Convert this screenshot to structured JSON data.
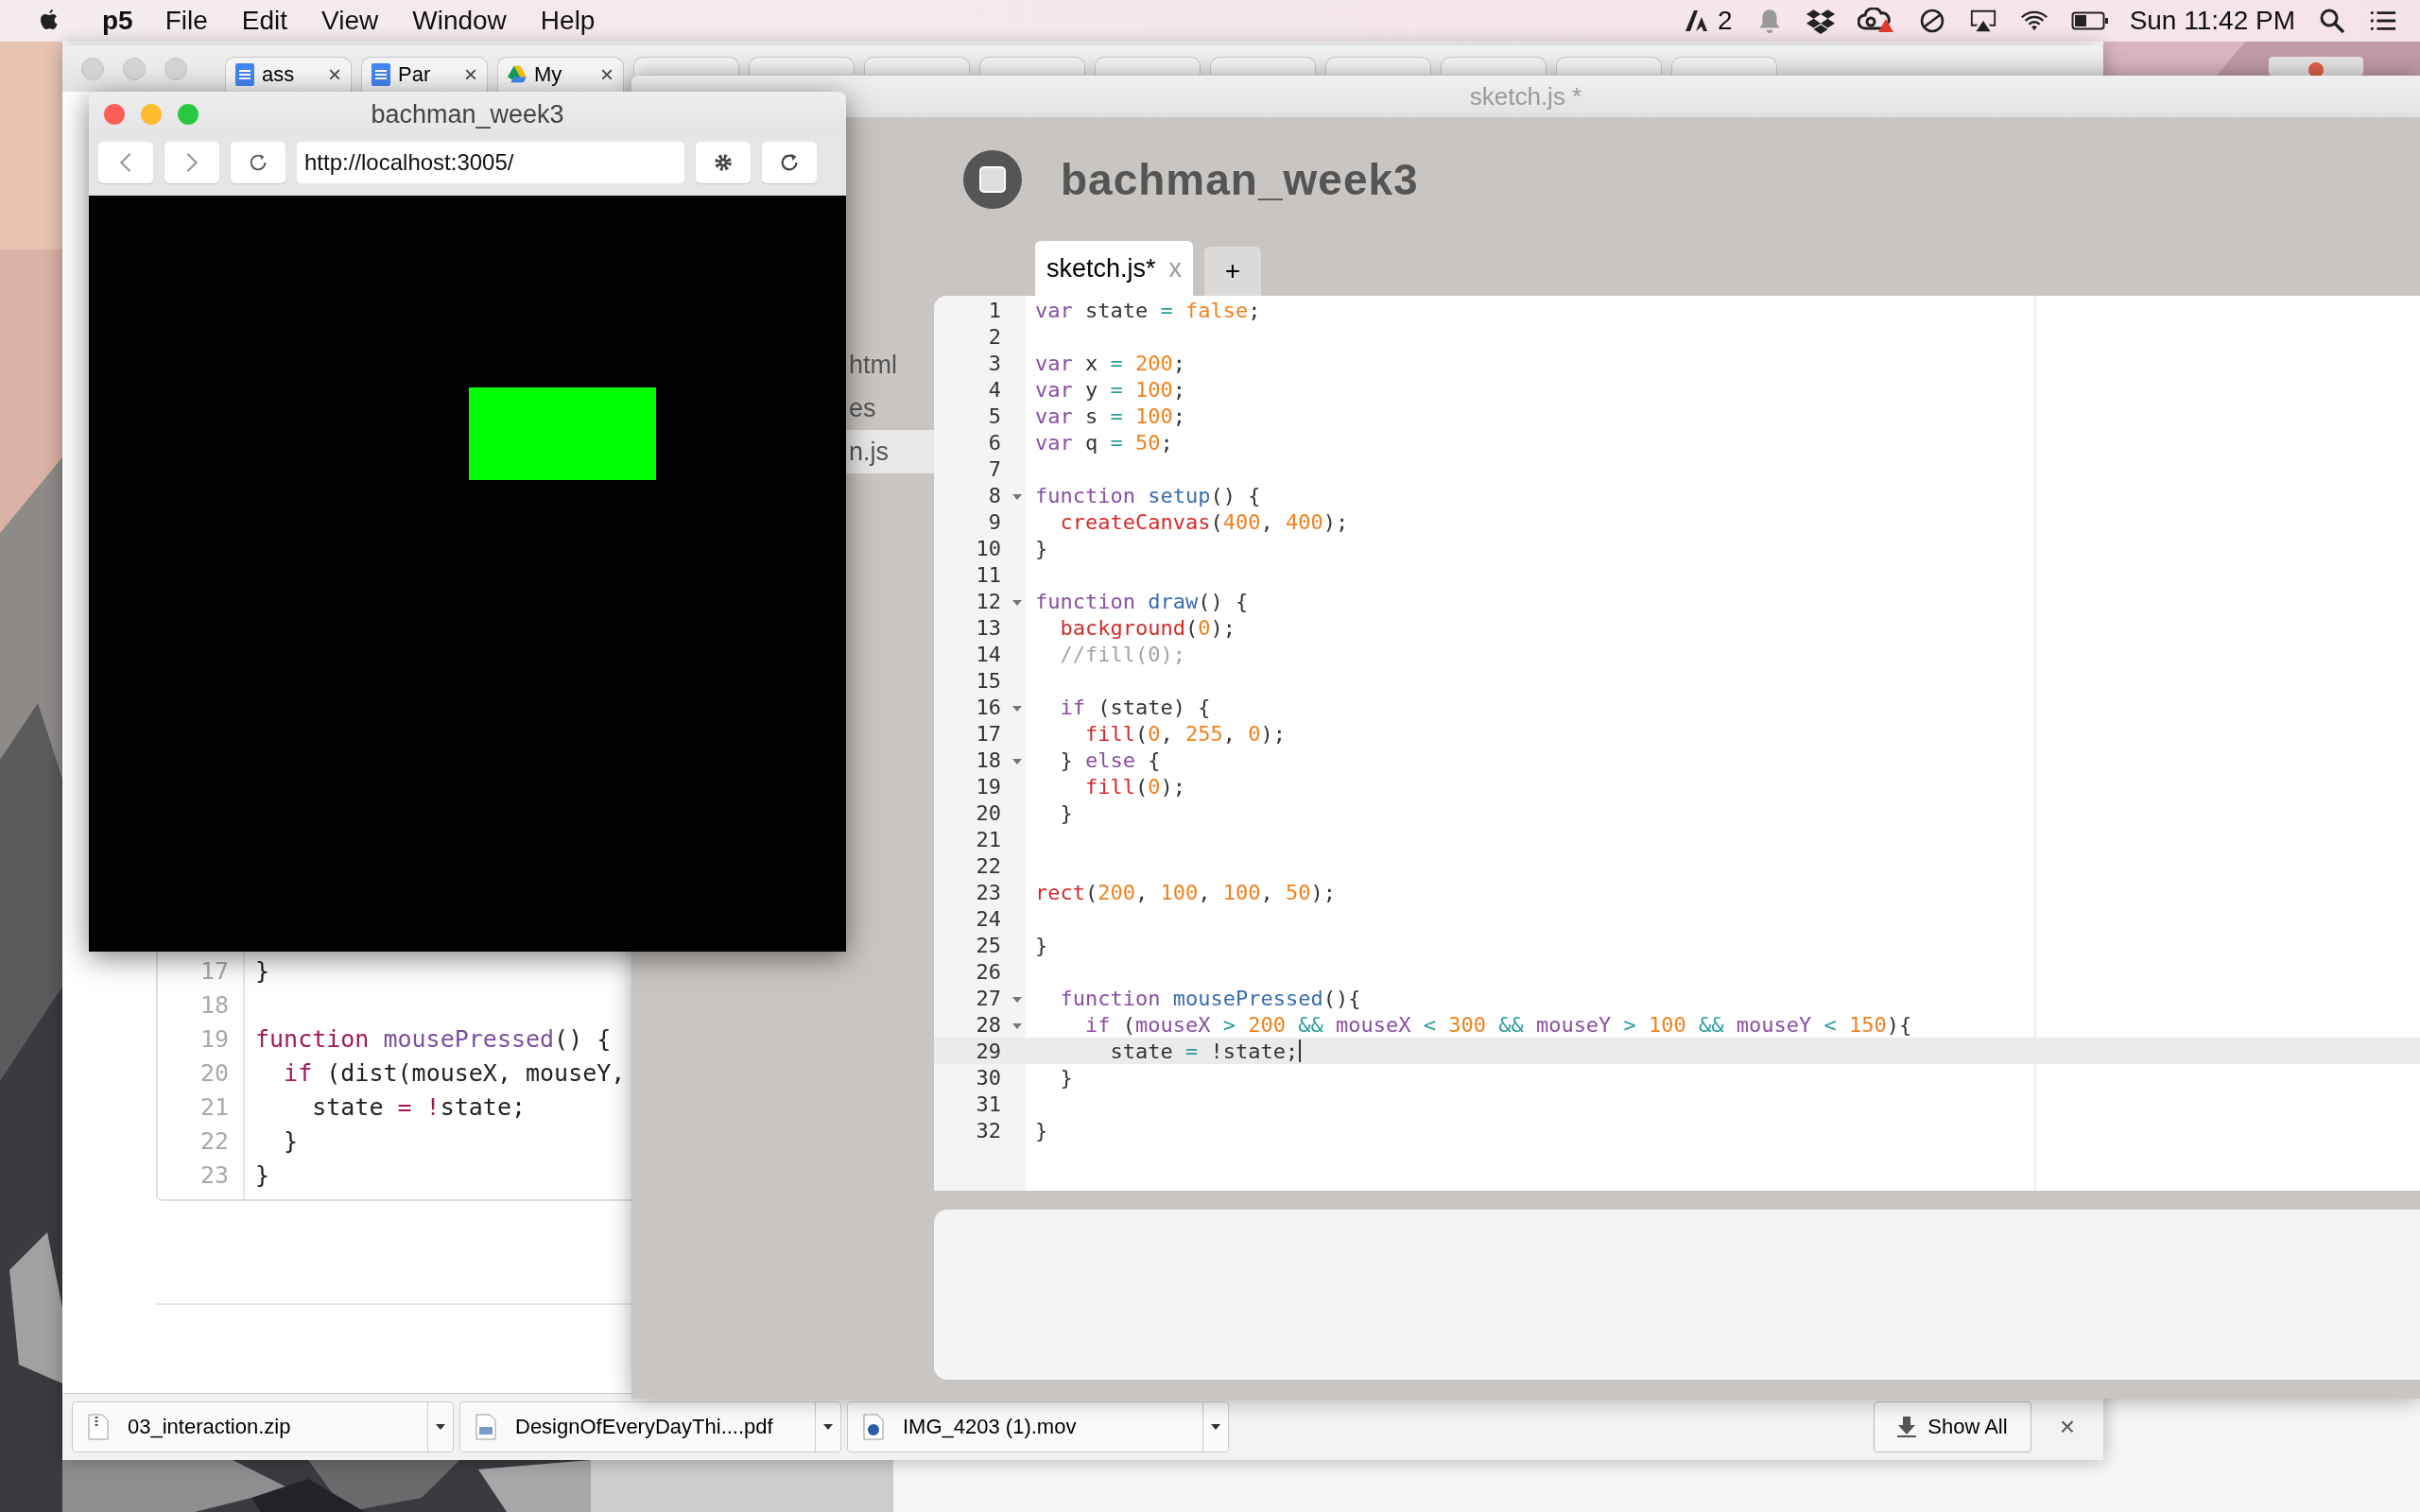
{
  "menu_bar": {
    "app": "p5",
    "menus": [
      "File",
      "Edit",
      "View",
      "Window",
      "Help"
    ],
    "adobe_count": "2",
    "clock": "Sun 11:42 PM"
  },
  "chrome": {
    "tabs": [
      {
        "kind": "doc",
        "title": "ass",
        "close": "×"
      },
      {
        "kind": "doc",
        "title": "Par",
        "close": "×"
      },
      {
        "kind": "drive",
        "title": "My",
        "close": "×"
      },
      {
        "kind": "covered"
      },
      {
        "kind": "covered"
      },
      {
        "kind": "covered"
      },
      {
        "kind": "covered"
      },
      {
        "kind": "covered"
      },
      {
        "kind": "covered"
      },
      {
        "kind": "covered"
      },
      {
        "kind": "covered"
      },
      {
        "kind": "covered"
      },
      {
        "kind": "covered"
      }
    ],
    "page_code": [
      {
        "number": "17",
        "tokens": [
          {
            "kind": "plain",
            "text": "}"
          }
        ]
      },
      {
        "number": "18"
      },
      {
        "number": "19",
        "tokens": [
          {
            "kind": "keyword",
            "text": "function "
          },
          {
            "kind": "name",
            "text": "mousePressed"
          },
          {
            "kind": "plain",
            "text": "() {"
          }
        ]
      },
      {
        "number": "20",
        "tokens": [
          {
            "kind": "keyword",
            "text": "  if"
          },
          {
            "kind": "plain",
            "text": " (dist(mouseX, mouseY,"
          }
        ]
      },
      {
        "number": "21",
        "tokens": [
          {
            "kind": "plain",
            "text": "    state "
          },
          {
            "kind": "op",
            "text": "= !"
          },
          {
            "kind": "plain",
            "text": "state;"
          }
        ]
      },
      {
        "number": "22",
        "tokens": [
          {
            "kind": "plain",
            "text": "  }"
          }
        ]
      },
      {
        "number": "23",
        "tokens": [
          {
            "kind": "plain",
            "text": "}"
          }
        ]
      }
    ],
    "downloads": [
      {
        "kind": "zip",
        "name": "03_interaction.zip"
      },
      {
        "kind": "pdf",
        "name": "DesignOfEveryDayThi....pdf"
      },
      {
        "kind": "video",
        "name": "IMG_4203 (1).mov"
      }
    ],
    "show_all": "Show All",
    "close": "×"
  },
  "ide": {
    "window_title": "sketch.js *",
    "project": "bachman_week3",
    "running": true,
    "files": [
      {
        "name": "html",
        "selected": false
      },
      {
        "name": "es",
        "selected": false
      },
      {
        "name": "n.js",
        "selected": true
      }
    ],
    "tabs": [
      {
        "title": "sketch.js*",
        "close": "x",
        "selected": true
      }
    ],
    "add_tab": "+",
    "code": [
      {
        "number": "1",
        "fold": false,
        "active": false,
        "tokens": [
          {
            "kind": "keyword",
            "text": "var "
          },
          {
            "kind": "plain",
            "text": "state "
          },
          {
            "kind": "op",
            "text": "= "
          },
          {
            "kind": "num",
            "text": "false"
          },
          {
            "kind": "plain",
            "text": ";"
          }
        ]
      },
      {
        "number": "2",
        "fold": false,
        "active": false
      },
      {
        "number": "3",
        "fold": false,
        "active": false,
        "tokens": [
          {
            "kind": "keyword",
            "text": "var "
          },
          {
            "kind": "plain",
            "text": "x "
          },
          {
            "kind": "op",
            "text": "= "
          },
          {
            "kind": "num",
            "text": "200"
          },
          {
            "kind": "plain",
            "text": ";"
          }
        ]
      },
      {
        "number": "4",
        "fold": false,
        "active": false,
        "tokens": [
          {
            "kind": "keyword",
            "text": "var "
          },
          {
            "kind": "plain",
            "text": "y "
          },
          {
            "kind": "op",
            "text": "= "
          },
          {
            "kind": "num",
            "text": "100"
          },
          {
            "kind": "plain",
            "text": ";"
          }
        ]
      },
      {
        "number": "5",
        "fold": false,
        "active": false,
        "tokens": [
          {
            "kind": "keyword",
            "text": "var "
          },
          {
            "kind": "plain",
            "text": "s "
          },
          {
            "kind": "op",
            "text": "= "
          },
          {
            "kind": "num",
            "text": "100"
          },
          {
            "kind": "plain",
            "text": ";"
          }
        ]
      },
      {
        "number": "6",
        "fold": false,
        "active": false,
        "tokens": [
          {
            "kind": "keyword",
            "text": "var "
          },
          {
            "kind": "plain",
            "text": "q "
          },
          {
            "kind": "op",
            "text": "= "
          },
          {
            "kind": "num",
            "text": "50"
          },
          {
            "kind": "plain",
            "text": ";"
          }
        ]
      },
      {
        "number": "7",
        "fold": false,
        "active": false
      },
      {
        "number": "8",
        "fold": true,
        "active": false,
        "tokens": [
          {
            "kind": "keyword",
            "text": "function "
          },
          {
            "kind": "name",
            "text": "setup"
          },
          {
            "kind": "plain",
            "text": "() {"
          }
        ]
      },
      {
        "number": "9",
        "fold": false,
        "active": false,
        "tokens": [
          {
            "kind": "builtin",
            "text": "  createCanvas"
          },
          {
            "kind": "plain",
            "text": "("
          },
          {
            "kind": "num",
            "text": "400"
          },
          {
            "kind": "plain",
            "text": ", "
          },
          {
            "kind": "num",
            "text": "400"
          },
          {
            "kind": "plain",
            "text": ");"
          }
        ]
      },
      {
        "number": "10",
        "fold": false,
        "active": false,
        "tokens": [
          {
            "kind": "plain",
            "text": "}"
          }
        ]
      },
      {
        "number": "11",
        "fold": false,
        "active": false
      },
      {
        "number": "12",
        "fold": true,
        "active": false,
        "tokens": [
          {
            "kind": "keyword",
            "text": "function "
          },
          {
            "kind": "name",
            "text": "draw"
          },
          {
            "kind": "plain",
            "text": "() {"
          }
        ]
      },
      {
        "number": "13",
        "fold": false,
        "active": false,
        "tokens": [
          {
            "kind": "builtin",
            "text": "  background"
          },
          {
            "kind": "plain",
            "text": "("
          },
          {
            "kind": "num",
            "text": "0"
          },
          {
            "kind": "plain",
            "text": ");"
          }
        ]
      },
      {
        "number": "14",
        "fold": false,
        "active": false,
        "tokens": [
          {
            "kind": "comment",
            "text": "  //fill(0);"
          }
        ]
      },
      {
        "number": "15",
        "fold": false,
        "active": false
      },
      {
        "number": "16",
        "fold": true,
        "active": false,
        "tokens": [
          {
            "kind": "keyword",
            "text": "  if"
          },
          {
            "kind": "plain",
            "text": " (state) {"
          }
        ]
      },
      {
        "number": "17",
        "fold": false,
        "active": false,
        "tokens": [
          {
            "kind": "builtin",
            "text": "    fill"
          },
          {
            "kind": "plain",
            "text": "("
          },
          {
            "kind": "num",
            "text": "0"
          },
          {
            "kind": "plain",
            "text": ", "
          },
          {
            "kind": "num",
            "text": "255"
          },
          {
            "kind": "plain",
            "text": ", "
          },
          {
            "kind": "num",
            "text": "0"
          },
          {
            "kind": "plain",
            "text": ");"
          }
        ]
      },
      {
        "number": "18",
        "fold": true,
        "active": false,
        "tokens": [
          {
            "kind": "plain",
            "text": "  } "
          },
          {
            "kind": "keyword",
            "text": "else"
          },
          {
            "kind": "plain",
            "text": " {"
          }
        ]
      },
      {
        "number": "19",
        "fold": false,
        "active": false,
        "tokens": [
          {
            "kind": "builtin",
            "text": "    fill"
          },
          {
            "kind": "plain",
            "text": "("
          },
          {
            "kind": "num",
            "text": "0"
          },
          {
            "kind": "plain",
            "text": ");"
          }
        ]
      },
      {
        "number": "20",
        "fold": false,
        "active": false,
        "tokens": [
          {
            "kind": "plain",
            "text": "  }"
          }
        ]
      },
      {
        "number": "21",
        "fold": false,
        "active": false
      },
      {
        "number": "22",
        "fold": false,
        "active": false
      },
      {
        "number": "23",
        "fold": false,
        "active": false,
        "tokens": [
          {
            "kind": "builtin",
            "text": "rect"
          },
          {
            "kind": "plain",
            "text": "("
          },
          {
            "kind": "num",
            "text": "200"
          },
          {
            "kind": "plain",
            "text": ", "
          },
          {
            "kind": "num",
            "text": "100"
          },
          {
            "kind": "plain",
            "text": ", "
          },
          {
            "kind": "num",
            "text": "100"
          },
          {
            "kind": "plain",
            "text": ", "
          },
          {
            "kind": "num",
            "text": "50"
          },
          {
            "kind": "plain",
            "text": ");"
          }
        ]
      },
      {
        "number": "24",
        "fold": false,
        "active": false
      },
      {
        "number": "25",
        "fold": false,
        "active": false,
        "tokens": [
          {
            "kind": "plain",
            "text": "}"
          }
        ]
      },
      {
        "number": "26",
        "fold": false,
        "active": false
      },
      {
        "number": "27",
        "fold": true,
        "active": false,
        "tokens": [
          {
            "kind": "keyword",
            "text": "  function "
          },
          {
            "kind": "name",
            "text": "mousePressed"
          },
          {
            "kind": "plain",
            "text": "(){"
          }
        ]
      },
      {
        "number": "28",
        "fold": true,
        "active": false,
        "tokens": [
          {
            "kind": "keyword",
            "text": "    if"
          },
          {
            "kind": "plain",
            "text": " ("
          },
          {
            "kind": "keyword",
            "text": "mouseX "
          },
          {
            "kind": "op",
            "text": "> "
          },
          {
            "kind": "num",
            "text": "200 "
          },
          {
            "kind": "op",
            "text": "&& "
          },
          {
            "kind": "keyword",
            "text": "mouseX "
          },
          {
            "kind": "op",
            "text": "< "
          },
          {
            "kind": "num",
            "text": "300 "
          },
          {
            "kind": "op",
            "text": "&& "
          },
          {
            "kind": "keyword",
            "text": "mouseY "
          },
          {
            "kind": "op",
            "text": "> "
          },
          {
            "kind": "num",
            "text": "100 "
          },
          {
            "kind": "op",
            "text": "&& "
          },
          {
            "kind": "keyword",
            "text": "mouseY "
          },
          {
            "kind": "op",
            "text": "< "
          },
          {
            "kind": "num",
            "text": "150"
          },
          {
            "kind": "plain",
            "text": "){"
          }
        ]
      },
      {
        "number": "29",
        "fold": false,
        "active": true,
        "tokens": [
          {
            "kind": "plain",
            "text": "      state "
          },
          {
            "kind": "op",
            "text": "= "
          },
          {
            "kind": "plain",
            "text": "!state;"
          }
        ]
      },
      {
        "number": "30",
        "fold": false,
        "active": false,
        "tokens": [
          {
            "kind": "plain",
            "text": "  }"
          }
        ]
      },
      {
        "number": "31",
        "fold": false,
        "active": false
      },
      {
        "number": "32",
        "fold": false,
        "active": false,
        "tokens": [
          {
            "kind": "plain",
            "text": "}"
          }
        ]
      }
    ]
  },
  "preview": {
    "title": "bachman_week3",
    "url": "http://localhost:3005/",
    "rect_filled": true
  }
}
